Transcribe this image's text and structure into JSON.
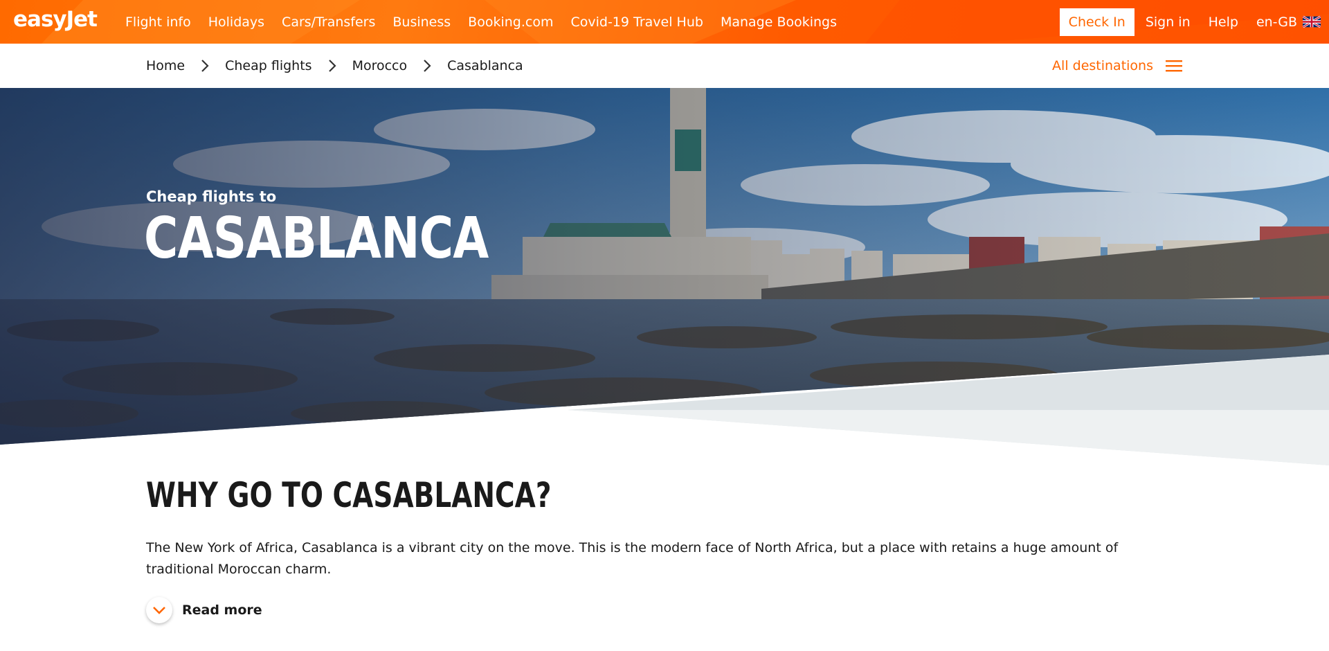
{
  "colors": {
    "brand_orange": "#ff6600",
    "text_dark": "#1a1a1a",
    "hero_overlay": "#2a3a5a"
  },
  "header": {
    "logo": "easyJet",
    "nav": [
      "Flight info",
      "Holidays",
      "Cars/Transfers",
      "Business",
      "Booking.com",
      "Covid-19 Travel Hub",
      "Manage Bookings"
    ],
    "check_in": "Check In",
    "sign_in": "Sign in",
    "help": "Help",
    "language": "en-GB",
    "language_flag_icon": "uk-flag-icon"
  },
  "breadcrumb": {
    "items": [
      "Home",
      "Cheap flights",
      "Morocco",
      "Casablanca"
    ],
    "separator_icon": "chevron-right-icon",
    "all_destinations": "All destinations",
    "menu_icon": "hamburger-menu-icon"
  },
  "hero": {
    "subtitle": "Cheap flights to",
    "title": "CASABLANCA"
  },
  "content": {
    "heading": "WHY GO TO CASABLANCA?",
    "intro": "The New York of Africa, Casablanca is a vibrant city on the move. This is the modern face of North Africa, but a place with retains a huge amount of traditional Moroccan charm.",
    "read_more": "Read more",
    "read_more_icon": "chevron-down-icon"
  }
}
